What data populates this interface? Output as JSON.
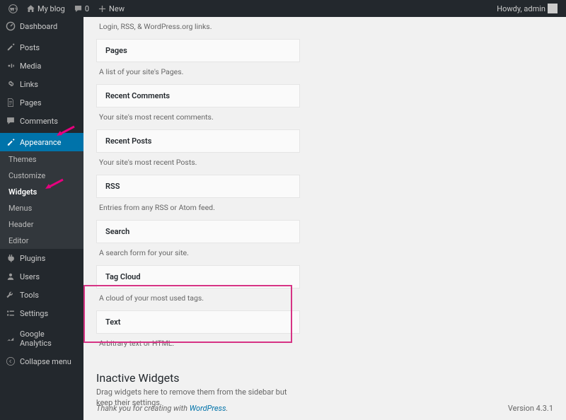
{
  "topbar": {
    "site_name": "My blog",
    "comments_count": "0",
    "new_label": "New",
    "greeting": "Howdy, admin"
  },
  "sidebar": {
    "items": [
      {
        "label": "Dashboard"
      },
      {
        "label": "Posts"
      },
      {
        "label": "Media"
      },
      {
        "label": "Links"
      },
      {
        "label": "Pages"
      },
      {
        "label": "Comments"
      },
      {
        "label": "Appearance"
      },
      {
        "label": "Plugins"
      },
      {
        "label": "Users"
      },
      {
        "label": "Tools"
      },
      {
        "label": "Settings"
      },
      {
        "label": "Google Analytics"
      },
      {
        "label": "Collapse menu"
      }
    ],
    "appearance_sub": [
      {
        "label": "Themes"
      },
      {
        "label": "Customize"
      },
      {
        "label": "Widgets"
      },
      {
        "label": "Menus"
      },
      {
        "label": "Header"
      },
      {
        "label": "Editor"
      }
    ]
  },
  "widgets": [
    {
      "desc": "Login, RSS, & WordPress.org links."
    },
    {
      "title": "Pages",
      "desc": "A list of your site's Pages."
    },
    {
      "title": "Recent Comments",
      "desc": "Your site's most recent comments."
    },
    {
      "title": "Recent Posts",
      "desc": "Your site's most recent Posts."
    },
    {
      "title": "RSS",
      "desc": "Entries from any RSS or Atom feed."
    },
    {
      "title": "Search",
      "desc": "A search form for your site."
    },
    {
      "title": "Tag Cloud",
      "desc": "A cloud of your most used tags."
    },
    {
      "title": "Text",
      "desc": "Arbitrary text or HTML."
    }
  ],
  "inactive": {
    "heading": "Inactive Widgets",
    "help": "Drag widgets here to remove them from the sidebar but keep their settings."
  },
  "footer": {
    "thanks_prefix": "Thank you for creating with ",
    "wp": "WordPress",
    "version": "Version 4.3.1"
  }
}
